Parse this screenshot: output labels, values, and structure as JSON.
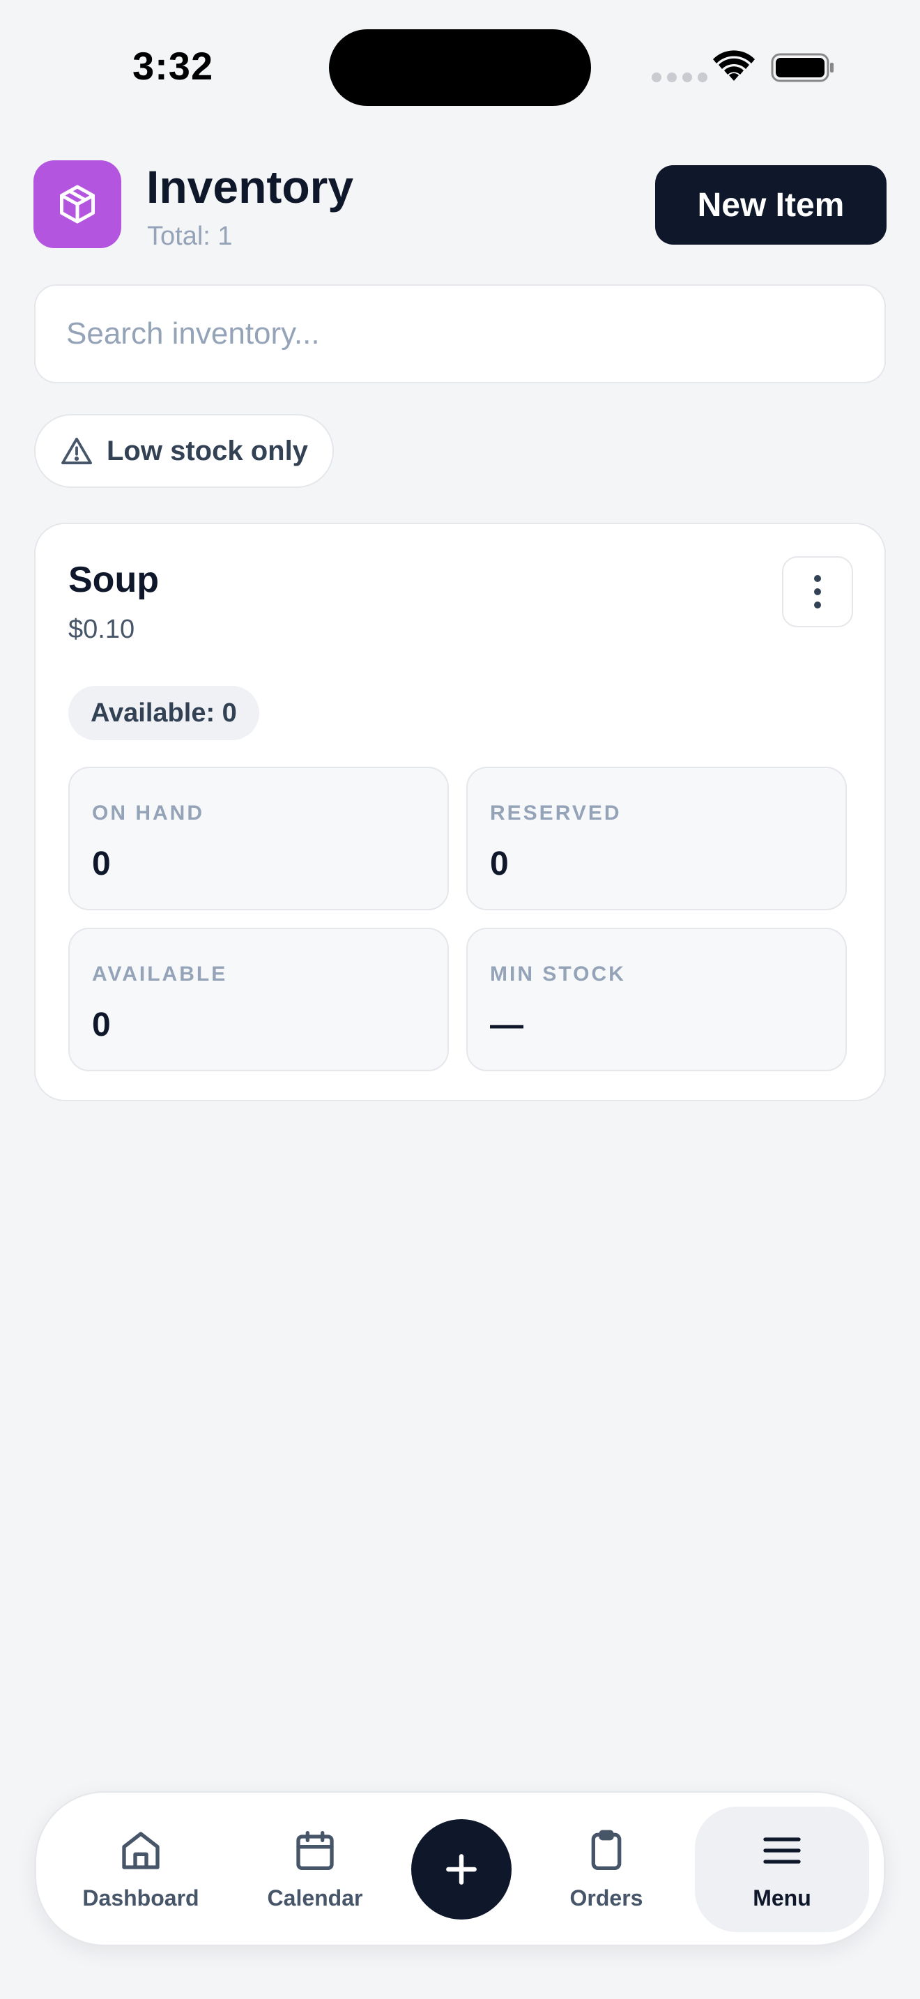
{
  "status_bar": {
    "time": "3:32"
  },
  "header": {
    "title": "Inventory",
    "subtitle": "Total: 1",
    "new_item_label": "New Item",
    "app_icon": "box-icon",
    "accent_color": "#b455e0"
  },
  "search": {
    "placeholder": "Search inventory...",
    "value": ""
  },
  "filter": {
    "label": "Low stock only",
    "icon": "warning-icon"
  },
  "items": [
    {
      "name": "Soup",
      "price": "$0.10",
      "available_badge": "Available: 0",
      "stats": {
        "on_hand": {
          "label": "ON HAND",
          "value": "0"
        },
        "reserved": {
          "label": "RESERVED",
          "value": "0"
        },
        "available": {
          "label": "AVAILABLE",
          "value": "0"
        },
        "min_stock": {
          "label": "MIN STOCK",
          "value": "—"
        }
      }
    }
  ],
  "bottom_nav": {
    "items": [
      {
        "label": "Dashboard",
        "icon": "home-icon"
      },
      {
        "label": "Calendar",
        "icon": "calendar-icon"
      },
      {
        "label": "Orders",
        "icon": "clipboard-icon"
      },
      {
        "label": "Menu",
        "icon": "menu-icon",
        "active": true
      }
    ],
    "fab_icon": "plus-icon"
  }
}
